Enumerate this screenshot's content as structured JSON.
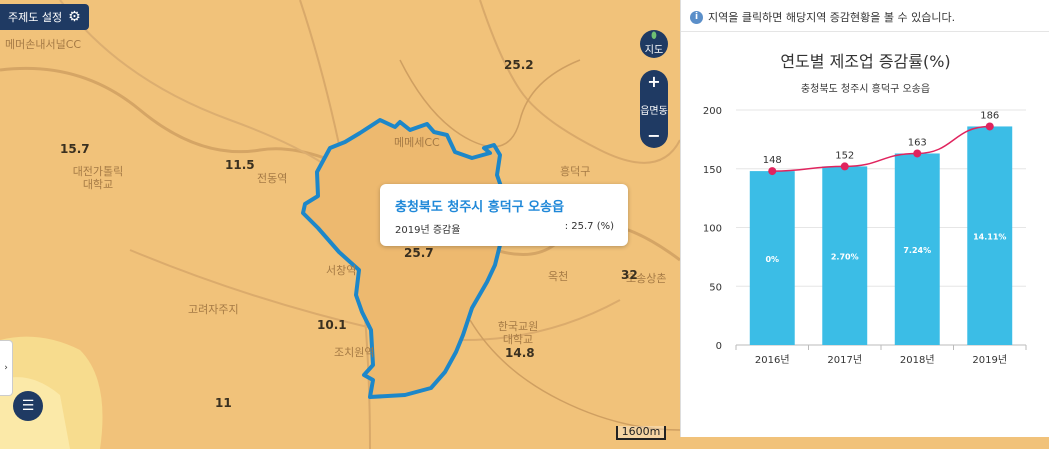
{
  "map": {
    "theme_button_label": "주제도 설정",
    "map_toggle_label": "지도",
    "zoom_in": "+",
    "zoom_out": "−",
    "zoom_level_label": "읍면동",
    "scale_label": "1600m",
    "region_values": [
      "15.7",
      "11.5",
      "25.2",
      "25.7",
      "10.1",
      "14.8",
      "11",
      "32"
    ],
    "place_names": [
      "메머손내서널CC",
      "대전가톨릭\n대학교",
      "전동역",
      "서창역",
      "고려자주지",
      "조치원역",
      "한국교원\n대학교",
      "메메세CC",
      "옥천",
      "흥덕구",
      "오송상촌"
    ],
    "tooltip": {
      "title": "충청북도 청주시 흥덕구 오송읍",
      "label": "2019년 증감율",
      "value": ": 25.7 (%)"
    }
  },
  "panel": {
    "info_text": "지역을 클릭하면 해당지역 증감현황을 볼 수 있습니다.",
    "chart_title": "연도별 제조업 증감률(%)",
    "chart_subtitle": "충청북도 청주시 흥덕구 오송읍"
  },
  "colors": {
    "bar": "#3bbde6",
    "line": "#e0245e",
    "navy": "#1f3a63",
    "map": "#f1c27a"
  },
  "chart_data": {
    "type": "bar",
    "title": "연도별 제조업 증감률(%)",
    "subtitle": "충청북도 청주시 흥덕구 오송읍",
    "categories": [
      "2016년",
      "2017년",
      "2018년",
      "2019년"
    ],
    "series": [
      {
        "type": "bar",
        "values": [
          148,
          152,
          163,
          186
        ],
        "labels": [
          "0%",
          "2.70%",
          "7.24%",
          "14.11%"
        ]
      },
      {
        "type": "line",
        "values": [
          148,
          152,
          163,
          186
        ]
      }
    ],
    "ylim": [
      0,
      200
    ],
    "yticks": [
      0,
      50,
      100,
      150,
      200
    ]
  }
}
